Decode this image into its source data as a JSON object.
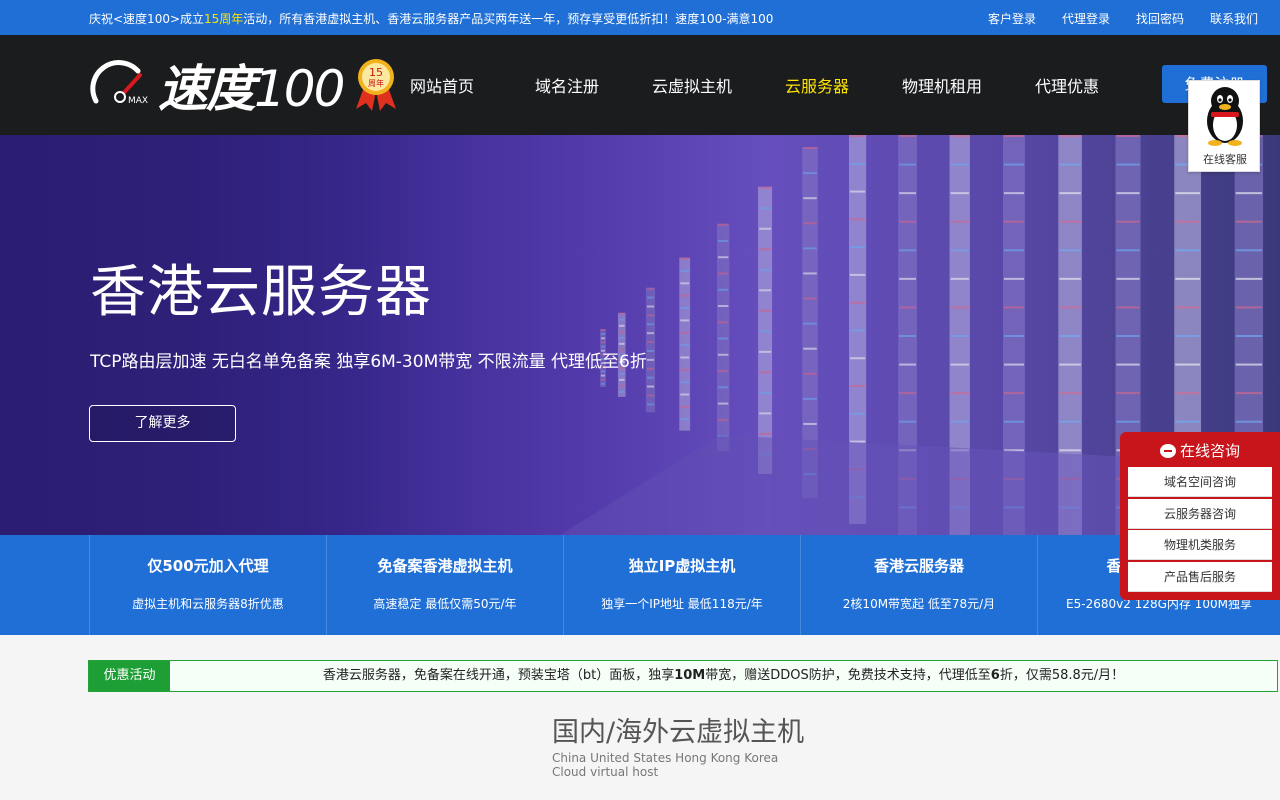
{
  "topbar": {
    "promo_pre": "庆祝<速度100>成立",
    "promo_hl": "15周年",
    "promo_post": "活动，所有香港虚拟主机、香港云服务器产品买两年送一年，预存享受更低折扣！速度100-满意100",
    "links": [
      "客户登录",
      "代理登录",
      "找回密码",
      "联系我们"
    ]
  },
  "logo": {
    "brand": "速度",
    "hundred": "100",
    "max": "MAX",
    "badge_num": "15",
    "badge_text": "周年"
  },
  "nav": [
    "网站首页",
    "域名注册",
    "云虚拟主机",
    "云服务器",
    "物理机租用",
    "代理优惠"
  ],
  "nav_active": "云服务器",
  "register_label": "免费注册",
  "qq": {
    "label": "在线客服"
  },
  "hero": {
    "title": "香港云服务器",
    "subtitle": "TCP路由层加速 无白名单免备案 独享6M-30M带宽 不限流量 代理低至6折",
    "button": "了解更多"
  },
  "features": [
    {
      "title": "仅500元加入代理",
      "desc": "虚拟主机和云服务器8折优惠"
    },
    {
      "title": "免备案香港虚拟主机",
      "desc": "高速稳定 最低仅需50元/年"
    },
    {
      "title": "独立IP虚拟主机",
      "desc": "独享一个IP地址 最低118元/年"
    },
    {
      "title": "香港云服务器",
      "desc": "2核10M带宽起 低至78元/月"
    },
    {
      "title": "香港物理服务器",
      "desc": "E5-2680v2 128G内存 100M独享"
    }
  ],
  "consult": {
    "title": "在线咨询",
    "items": [
      "域名空间咨询",
      "云服务器咨询",
      "物理机类服务",
      "产品售后服务"
    ]
  },
  "promo_bar": {
    "tag": "优惠活动",
    "text_a": "香港云服务器，免备案在线开通，预装宝塔（bt）面板，独享",
    "bold_a": "10M",
    "text_b": "带宽，赠送DDOS防护，免费技术支持，代理低至",
    "bold_b": "6",
    "text_c": "折，仅需58.8元/月！"
  },
  "section": {
    "title": "国内/海外云虚拟主机",
    "en_line1": "China United States Hong Kong Korea",
    "en_line2": "Cloud virtual host"
  },
  "colors": {
    "blue": "#1f6fd6",
    "header": "#1b1c1e",
    "accent_yellow": "#ffe400",
    "red": "#c8151c",
    "green": "#1e9f36"
  }
}
